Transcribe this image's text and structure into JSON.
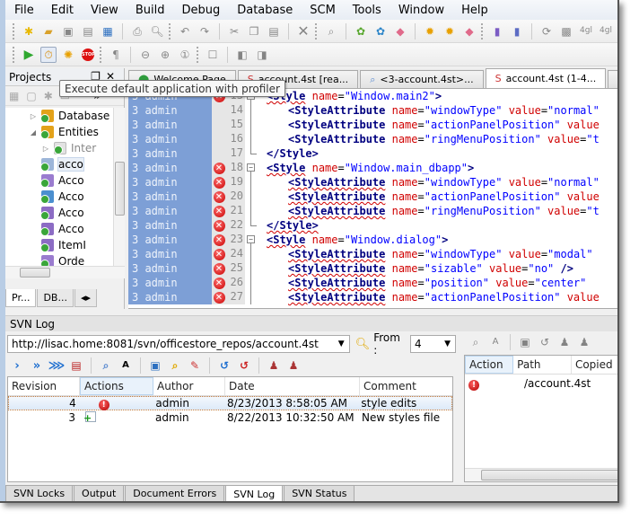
{
  "menu": [
    "File",
    "Edit",
    "View",
    "Build",
    "Debug",
    "Database",
    "SCM",
    "Tools",
    "Window",
    "Help"
  ],
  "toolbar1": {
    "icons": [
      "new-file-icon",
      "open-file-icon",
      "save-icon",
      "save-as-icon",
      "save-all-icon",
      "print-icon",
      "print-preview-icon",
      "undo-icon",
      "redo-icon",
      "cut-icon",
      "copy-icon",
      "paste-icon",
      "delete-icon",
      "find-icon",
      "compile-icon",
      "link-icon",
      "clean-icon",
      "build-icon",
      "rebuild-icon",
      "clean-all-icon",
      "new-database-icon",
      "import-database-icon",
      "refresh-icon",
      "deploy-icon",
      "4gl-icon",
      "4gl-alt-icon"
    ]
  },
  "toolbar2": {
    "icons": [
      "run-icon",
      "profiler-icon",
      "debug-icon",
      "stop-icon",
      "paragraph-icon",
      "zoom-out-icon",
      "zoom-in-icon",
      "zoom-reset-icon",
      "split-icon",
      "previous-icon",
      "next-icon"
    ]
  },
  "tooltip": "Execute default application with profiler",
  "projects": {
    "title": "Projects",
    "tree": [
      {
        "label": "Database",
        "expanded": false,
        "indent": 1
      },
      {
        "label": "Entities",
        "expanded": true,
        "indent": 1
      },
      {
        "label": "Inter",
        "expanded": false,
        "indent": 2,
        "dim": true
      },
      {
        "label": "acco",
        "indent": 2,
        "selected": true
      },
      {
        "label": "Acco",
        "indent": 2
      },
      {
        "label": "Acco",
        "indent": 2
      },
      {
        "label": "Acco",
        "indent": 2
      },
      {
        "label": "Acco",
        "indent": 2
      },
      {
        "label": "ItemI",
        "indent": 2
      },
      {
        "label": "Orde",
        "indent": 2
      }
    ],
    "tabs": [
      "Pr...",
      "DB..."
    ]
  },
  "editor": {
    "tabs": [
      {
        "label": "Welcome Page",
        "icon": "welcome-icon"
      },
      {
        "label": "account.4st [rea...",
        "icon": "file-icon"
      },
      {
        "label": "<3-account.4st>...",
        "icon": "diff-icon"
      },
      {
        "label": "account.4st (1-4...",
        "icon": "style-file-icon",
        "active": true
      }
    ],
    "lines": [
      {
        "rev": "3",
        "author": "admin",
        "num": "13",
        "err": true,
        "fold": "start",
        "indent": 0,
        "tokens": [
          [
            "tag",
            "<Style"
          ],
          [
            "plain",
            " "
          ],
          [
            "attr",
            "name"
          ],
          [
            "plain",
            "="
          ],
          [
            "val",
            "\"Window.main2\""
          ],
          [
            "tag",
            ">"
          ]
        ]
      },
      {
        "rev": "3",
        "author": "admin",
        "num": "14",
        "err": false,
        "fold": "line",
        "indent": 1,
        "tokens": [
          [
            "tag",
            "<StyleAttribute"
          ],
          [
            "plain",
            " "
          ],
          [
            "attr",
            "name"
          ],
          [
            "plain",
            "="
          ],
          [
            "val",
            "\"windowType\""
          ],
          [
            "plain",
            " "
          ],
          [
            "attr",
            "value"
          ],
          [
            "plain",
            "="
          ],
          [
            "val",
            "\"normal\""
          ]
        ]
      },
      {
        "rev": "3",
        "author": "admin",
        "num": "15",
        "err": false,
        "fold": "line",
        "indent": 1,
        "tokens": [
          [
            "tag",
            "<StyleAttribute"
          ],
          [
            "plain",
            " "
          ],
          [
            "attr",
            "name"
          ],
          [
            "plain",
            "="
          ],
          [
            "val",
            "\"actionPanelPosition\""
          ],
          [
            "plain",
            " "
          ],
          [
            "attr",
            "value"
          ]
        ]
      },
      {
        "rev": "3",
        "author": "admin",
        "num": "16",
        "err": false,
        "fold": "line",
        "indent": 1,
        "tokens": [
          [
            "tag",
            "<StyleAttribute"
          ],
          [
            "plain",
            " "
          ],
          [
            "attr",
            "name"
          ],
          [
            "plain",
            "="
          ],
          [
            "val",
            "\"ringMenuPosition\""
          ],
          [
            "plain",
            " "
          ],
          [
            "attr",
            "value"
          ],
          [
            "plain",
            "="
          ],
          [
            "val",
            "\"t"
          ]
        ]
      },
      {
        "rev": "3",
        "author": "admin",
        "num": "17",
        "err": false,
        "fold": "end",
        "indent": 0,
        "tokens": [
          [
            "tag",
            "</Style>"
          ]
        ]
      },
      {
        "rev": "3",
        "author": "admin",
        "num": "18",
        "err": true,
        "fold": "start",
        "indent": 0,
        "tokens": [
          [
            "tag",
            "<Style"
          ],
          [
            "plain",
            " "
          ],
          [
            "attr",
            "name"
          ],
          [
            "plain",
            "="
          ],
          [
            "val",
            "\"Window.main_dbapp\""
          ],
          [
            "tag",
            ">"
          ]
        ]
      },
      {
        "rev": "3",
        "author": "admin",
        "num": "19",
        "err": true,
        "fold": "line",
        "indent": 1,
        "tokens": [
          [
            "tag",
            "<StyleAttribute"
          ],
          [
            "plain",
            " "
          ],
          [
            "attr",
            "name"
          ],
          [
            "plain",
            "="
          ],
          [
            "val",
            "\"windowType\""
          ],
          [
            "plain",
            " "
          ],
          [
            "attr",
            "value"
          ],
          [
            "plain",
            "="
          ],
          [
            "val",
            "\"normal\""
          ]
        ]
      },
      {
        "rev": "3",
        "author": "admin",
        "num": "20",
        "err": true,
        "fold": "line",
        "indent": 1,
        "tokens": [
          [
            "tag",
            "<StyleAttribute"
          ],
          [
            "plain",
            " "
          ],
          [
            "attr",
            "name"
          ],
          [
            "plain",
            "="
          ],
          [
            "val",
            "\"actionPanelPosition\""
          ],
          [
            "plain",
            " "
          ],
          [
            "attr",
            "value"
          ]
        ]
      },
      {
        "rev": "3",
        "author": "admin",
        "num": "21",
        "err": true,
        "fold": "line",
        "indent": 1,
        "tokens": [
          [
            "tag",
            "<StyleAttribute"
          ],
          [
            "plain",
            " "
          ],
          [
            "attr",
            "name"
          ],
          [
            "plain",
            "="
          ],
          [
            "val",
            "\"ringMenuPosition\""
          ],
          [
            "plain",
            " "
          ],
          [
            "attr",
            "value"
          ],
          [
            "plain",
            "="
          ],
          [
            "val",
            "\"t"
          ]
        ]
      },
      {
        "rev": "3",
        "author": "admin",
        "num": "22",
        "err": true,
        "fold": "end",
        "indent": 0,
        "tokens": [
          [
            "tag",
            "</Style>"
          ]
        ]
      },
      {
        "rev": "3",
        "author": "admin",
        "num": "23",
        "err": true,
        "fold": "start",
        "indent": 0,
        "tokens": [
          [
            "tag",
            "<Style"
          ],
          [
            "plain",
            " "
          ],
          [
            "attr",
            "name"
          ],
          [
            "plain",
            "="
          ],
          [
            "val",
            "\"Window.dialog\""
          ],
          [
            "tag",
            ">"
          ]
        ]
      },
      {
        "rev": "3",
        "author": "admin",
        "num": "24",
        "err": true,
        "fold": "line",
        "indent": 1,
        "tokens": [
          [
            "tag",
            "<StyleAttribute"
          ],
          [
            "plain",
            " "
          ],
          [
            "attr",
            "name"
          ],
          [
            "plain",
            "="
          ],
          [
            "val",
            "\"windowType\""
          ],
          [
            "plain",
            " "
          ],
          [
            "attr",
            "value"
          ],
          [
            "plain",
            "="
          ],
          [
            "val",
            "\"modal\""
          ]
        ]
      },
      {
        "rev": "3",
        "author": "admin",
        "num": "25",
        "err": true,
        "fold": "line",
        "indent": 1,
        "tokens": [
          [
            "tag",
            "<StyleAttribute"
          ],
          [
            "plain",
            " "
          ],
          [
            "attr",
            "name"
          ],
          [
            "plain",
            "="
          ],
          [
            "val",
            "\"sizable\""
          ],
          [
            "plain",
            " "
          ],
          [
            "attr",
            "value"
          ],
          [
            "plain",
            "="
          ],
          [
            "val",
            "\"no\""
          ],
          [
            "plain",
            " "
          ],
          [
            "tag",
            "/>"
          ]
        ]
      },
      {
        "rev": "3",
        "author": "admin",
        "num": "26",
        "err": true,
        "fold": "line",
        "indent": 1,
        "tokens": [
          [
            "tag",
            "<StyleAttribute"
          ],
          [
            "plain",
            " "
          ],
          [
            "attr",
            "name"
          ],
          [
            "plain",
            "="
          ],
          [
            "val",
            "\"position\""
          ],
          [
            "plain",
            " "
          ],
          [
            "attr",
            "value"
          ],
          [
            "plain",
            "="
          ],
          [
            "val",
            "\"center\""
          ]
        ]
      },
      {
        "rev": "3",
        "author": "admin",
        "num": "27",
        "err": true,
        "fold": "line",
        "indent": 1,
        "tokens": [
          [
            "tag",
            "<StyleAttribute"
          ],
          [
            "plain",
            " "
          ],
          [
            "attr",
            "name"
          ],
          [
            "plain",
            "="
          ],
          [
            "val",
            "\"actionPanelPosition\""
          ],
          [
            "plain",
            " "
          ],
          [
            "attr",
            "value"
          ]
        ]
      }
    ]
  },
  "svn_log": {
    "title": "SVN Log",
    "url": "http://lisac.home:8081/svn/officestore_repos/account.4st",
    "from_label": "From :",
    "from_value": "4",
    "columns": [
      "Revision",
      "Actions",
      "Author",
      "Date",
      "Comment"
    ],
    "rows": [
      {
        "revision": "4",
        "action": "modified",
        "author": "admin",
        "date": "8/23/2013 8:58:05 AM",
        "comment": "style edits",
        "selected": true
      },
      {
        "revision": "3",
        "action": "added",
        "author": "admin",
        "date": "8/22/2013 10:32:50 AM",
        "comment": "New styles file"
      }
    ],
    "paths_columns": [
      "Action",
      "Path",
      "Copied"
    ],
    "paths_rows": [
      {
        "action": "modified",
        "path": "/account.4st"
      }
    ]
  },
  "bottom_tabs": [
    {
      "label": "SVN Locks"
    },
    {
      "label": "Output"
    },
    {
      "label": "Document Errors"
    },
    {
      "label": "SVN Log",
      "active": true
    },
    {
      "label": "SVN Status"
    }
  ]
}
